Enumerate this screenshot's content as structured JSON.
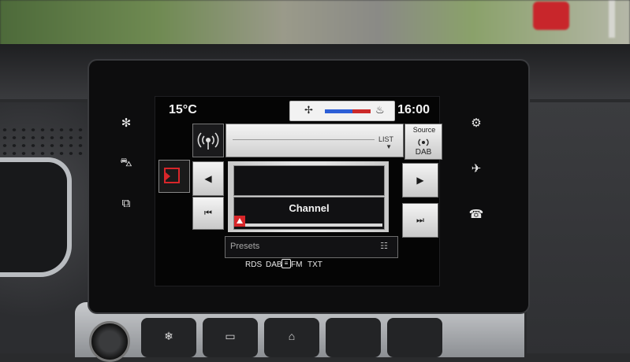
{
  "status_bar": {
    "temperature": "15°C",
    "time": "16:00"
  },
  "radio": {
    "list_label": "LIST",
    "source_label": "Source",
    "source_value": "DAB",
    "channel_label": "Channel",
    "presets_label": "Presets"
  },
  "bottom_bar": {
    "rds": "RDS",
    "dab": "DAB",
    "fm": "FM",
    "txt": "TXT"
  },
  "icons": {
    "left": [
      "fan-settings-icon",
      "car-icon",
      "phone-mirror-icon"
    ],
    "right": [
      "gear-icon",
      "plane-icon",
      "phone-book-icon"
    ]
  },
  "colors": {
    "accent_red": "#d8262a",
    "tile_light": "#e8e8e8",
    "screen_bg": "#050505"
  }
}
